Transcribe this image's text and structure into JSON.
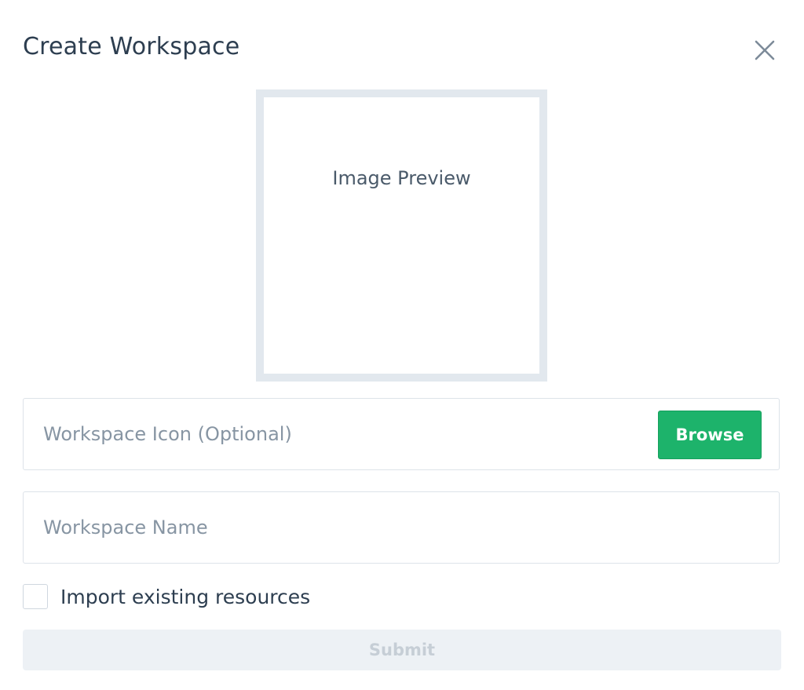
{
  "dialog": {
    "title": "Create Workspace",
    "close_icon": "close-icon"
  },
  "preview": {
    "label": "Image Preview"
  },
  "icon_field": {
    "placeholder": "Workspace Icon (Optional)",
    "value": "",
    "browse_label": "Browse"
  },
  "name_field": {
    "placeholder": "Workspace Name",
    "value": ""
  },
  "import_option": {
    "label": "Import existing resources",
    "checked": false
  },
  "submit": {
    "label": "Submit",
    "disabled": true
  },
  "colors": {
    "accent": "#1db36b",
    "title": "#2d3e50",
    "placeholder": "#8795a3",
    "border": "#dde3e9",
    "disabled_bg": "#edf1f5",
    "disabled_text": "#c6ced6"
  }
}
